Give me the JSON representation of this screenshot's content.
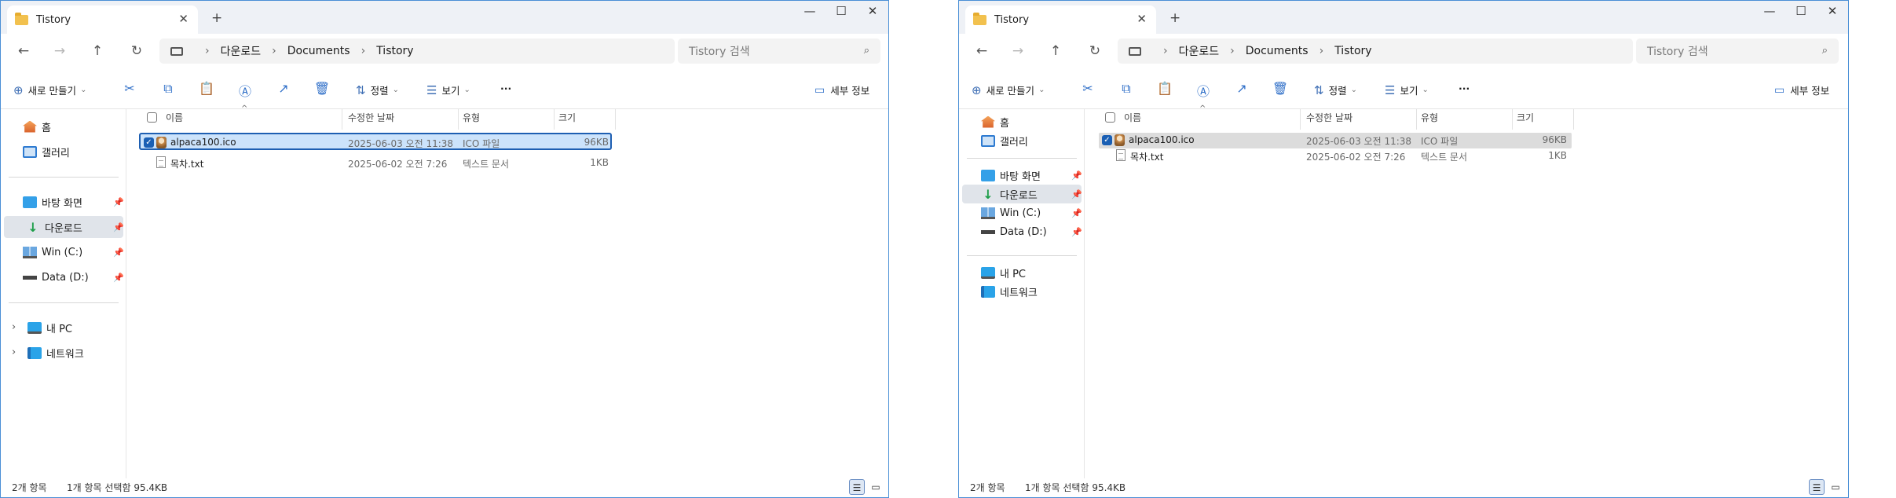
{
  "windows": [
    {
      "id": "left",
      "tab_title": "Tistory",
      "tab_close": "✕",
      "new_tab": "+",
      "controls": {
        "minimize": "—",
        "maximize": "☐",
        "close": "✕"
      },
      "nav": {
        "back": "←",
        "forward": "→",
        "up": "↑",
        "refresh": "↻"
      },
      "breadcrumb": [
        "다운로드",
        "Documents",
        "Tistory"
      ],
      "breadcrumb_sep": "›",
      "search_placeholder": "Tistory 검색",
      "search_icon": "⌕",
      "toolbar": {
        "new_label": "새로 만들기",
        "new_icon": "⊕",
        "sort_label": "정렬",
        "sort_icon": "⇅",
        "view_label": "보기",
        "view_icon": "☰",
        "more": "···",
        "details_label": "세부 정보",
        "details_icon": "▭",
        "chevron": "⌄",
        "icons": {
          "cut": "✂",
          "copy": "⧉",
          "paste": "📋",
          "rename": "Ⓐ",
          "share": "↗",
          "delete": "🗑"
        }
      },
      "sidebar": {
        "items": [
          {
            "label": "홈",
            "icon": "home-icon"
          },
          {
            "label": "갤러리",
            "icon": "gallery-icon"
          },
          {
            "label": "바탕 화면",
            "icon": "desktop-icon",
            "pinned": true
          },
          {
            "label": "다운로드",
            "icon": "download-icon",
            "pinned": true,
            "selected": true
          },
          {
            "label": "Win (C:)",
            "icon": "drive-windows-icon",
            "pinned": true
          },
          {
            "label": "Data (D:)",
            "icon": "drive-icon",
            "pinned": true
          },
          {
            "label": "내 PC",
            "icon": "pc-icon",
            "expandable": true
          },
          {
            "label": "네트워크",
            "icon": "network-icon",
            "expandable": true
          }
        ],
        "pin_glyph": "📌",
        "expand_glyph": "›",
        "down_glyph": "↓"
      },
      "columns": [
        "이름",
        "수정한 날짜",
        "유형",
        "크기"
      ],
      "sort_glyph": "^",
      "files": [
        {
          "name": "alpaca100.ico",
          "modified": "2025-06-03 오전 11:38",
          "type": "ICO 파일",
          "size": "96KB",
          "selected": true
        },
        {
          "name": "목차.txt",
          "modified": "2025-06-02 오전 7:26",
          "type": "텍스트 문서",
          "size": "1KB",
          "selected": false
        }
      ],
      "check_glyph": "✓",
      "status": {
        "count": "2개 항목",
        "selection": "1개 항목 선택함 95.4KB"
      },
      "view_icons": {
        "details": "☰",
        "tiles": "▭"
      }
    },
    {
      "id": "right",
      "tab_title": "Tistory",
      "tab_close": "✕",
      "new_tab": "+",
      "controls": {
        "minimize": "—",
        "maximize": "☐",
        "close": "✕"
      },
      "nav": {
        "back": "←",
        "forward": "→",
        "up": "↑",
        "refresh": "↻"
      },
      "breadcrumb": [
        "다운로드",
        "Documents",
        "Tistory"
      ],
      "breadcrumb_sep": "›",
      "search_placeholder": "Tistory 검색",
      "search_icon": "⌕",
      "toolbar": {
        "new_label": "새로 만들기",
        "new_icon": "⊕",
        "sort_label": "정렬",
        "sort_icon": "⇅",
        "view_label": "보기",
        "view_icon": "☰",
        "more": "···",
        "details_label": "세부 정보",
        "details_icon": "▭",
        "chevron": "⌄",
        "icons": {
          "cut": "✂",
          "copy": "⧉",
          "paste": "📋",
          "rename": "Ⓐ",
          "share": "↗",
          "delete": "🗑"
        }
      },
      "sidebar": {
        "items": [
          {
            "label": "홈",
            "icon": "home-icon"
          },
          {
            "label": "갤러리",
            "icon": "gallery-icon"
          },
          {
            "label": "바탕 화면",
            "icon": "desktop-icon",
            "pinned": true
          },
          {
            "label": "다운로드",
            "icon": "download-icon",
            "pinned": true,
            "selected": true
          },
          {
            "label": "Win (C:)",
            "icon": "drive-windows-icon",
            "pinned": true
          },
          {
            "label": "Data (D:)",
            "icon": "drive-icon",
            "pinned": true
          },
          {
            "label": "내 PC",
            "icon": "pc-icon"
          },
          {
            "label": "네트워크",
            "icon": "network-icon"
          }
        ],
        "pin_glyph": "📌",
        "down_glyph": "↓"
      },
      "columns": [
        "이름",
        "수정한 날짜",
        "유형",
        "크기"
      ],
      "sort_glyph": "^",
      "files": [
        {
          "name": "alpaca100.ico",
          "modified": "2025-06-03 오전 11:38",
          "type": "ICO 파일",
          "size": "96KB",
          "selected": true
        },
        {
          "name": "목차.txt",
          "modified": "2025-06-02 오전 7:26",
          "type": "텍스트 문서",
          "size": "1KB",
          "selected": false
        }
      ],
      "check_glyph": "✓",
      "status": {
        "count": "2개 항목",
        "selection": "1개 항목 선택함 95.4KB"
      },
      "view_icons": {
        "details": "☰",
        "tiles": "▭"
      }
    }
  ]
}
